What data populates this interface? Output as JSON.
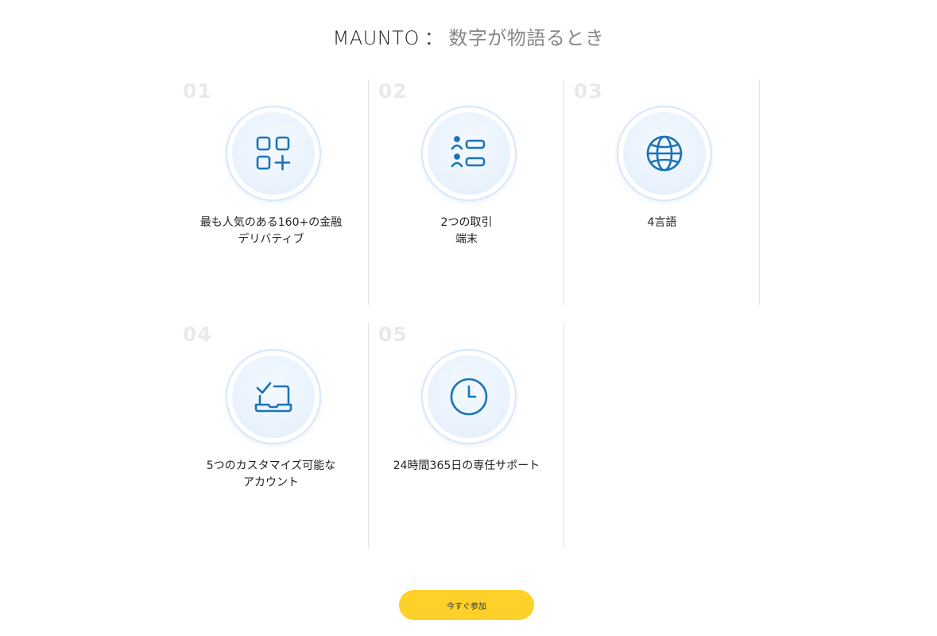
{
  "header": {
    "brand": "MAUNTO",
    "colon": "：",
    "rest": "数字が物語るとき"
  },
  "features": [
    {
      "num": "01",
      "icon": "apps-grid-plus-icon",
      "line1": "最も人気のある160+の金融",
      "line2": "デリバティブ"
    },
    {
      "num": "02",
      "icon": "user-list-icon",
      "line1": "2つの取引",
      "line2": "端末"
    },
    {
      "num": "03",
      "icon": "globe-icon",
      "line1": "4言語",
      "line2": ""
    },
    {
      "num": "04",
      "icon": "laptop-check-icon",
      "line1": "5つのカスタマイズ可能な",
      "line2": "アカウント"
    },
    {
      "num": "05",
      "icon": "clock-icon",
      "line1": "24時間365日の専任サポート",
      "line2": ""
    }
  ],
  "cta": {
    "label": "今すぐ参加"
  },
  "colors": {
    "accent": "#fdd12a",
    "icon": "#1b74b7"
  }
}
